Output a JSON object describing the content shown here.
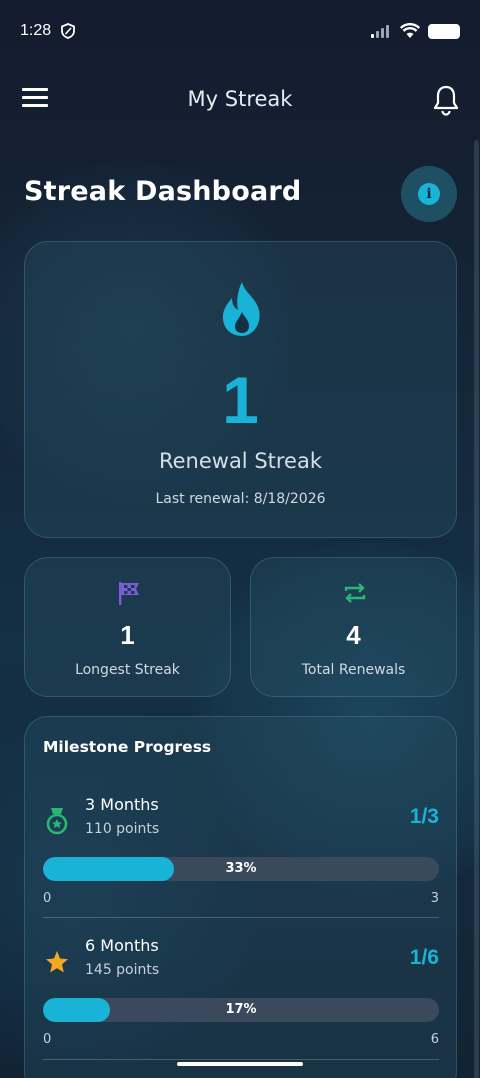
{
  "status_bar": {
    "time": "1:28"
  },
  "app_bar": {
    "title": "My Streak"
  },
  "dashboard": {
    "title": "Streak Dashboard"
  },
  "streak": {
    "value": "1",
    "label": "Renewal Streak",
    "last_renewal": "Last renewal: 8/18/2026"
  },
  "stats": [
    {
      "value": "1",
      "label": "Longest Streak",
      "icon": "checkered-flag-icon"
    },
    {
      "value": "4",
      "label": "Total Renewals",
      "icon": "repeat-icon"
    }
  ],
  "milestones": {
    "title": "Milestone Progress",
    "items": [
      {
        "name": "3 Months",
        "points": "110 points",
        "ratio": "1/3",
        "progress": 0.33,
        "percent": "33%",
        "min": "0",
        "max": "3",
        "icon": "medal-icon"
      },
      {
        "name": "6 Months",
        "points": "145 points",
        "ratio": "1/6",
        "progress": 0.17,
        "percent": "17%",
        "min": "0",
        "max": "6",
        "icon": "star-icon"
      }
    ]
  },
  "colors": {
    "accent": "#19b3d8",
    "flag": "#7b5cd6",
    "repeat": "#2bb673",
    "medal": "#2bb673",
    "star": "#f5a623"
  }
}
